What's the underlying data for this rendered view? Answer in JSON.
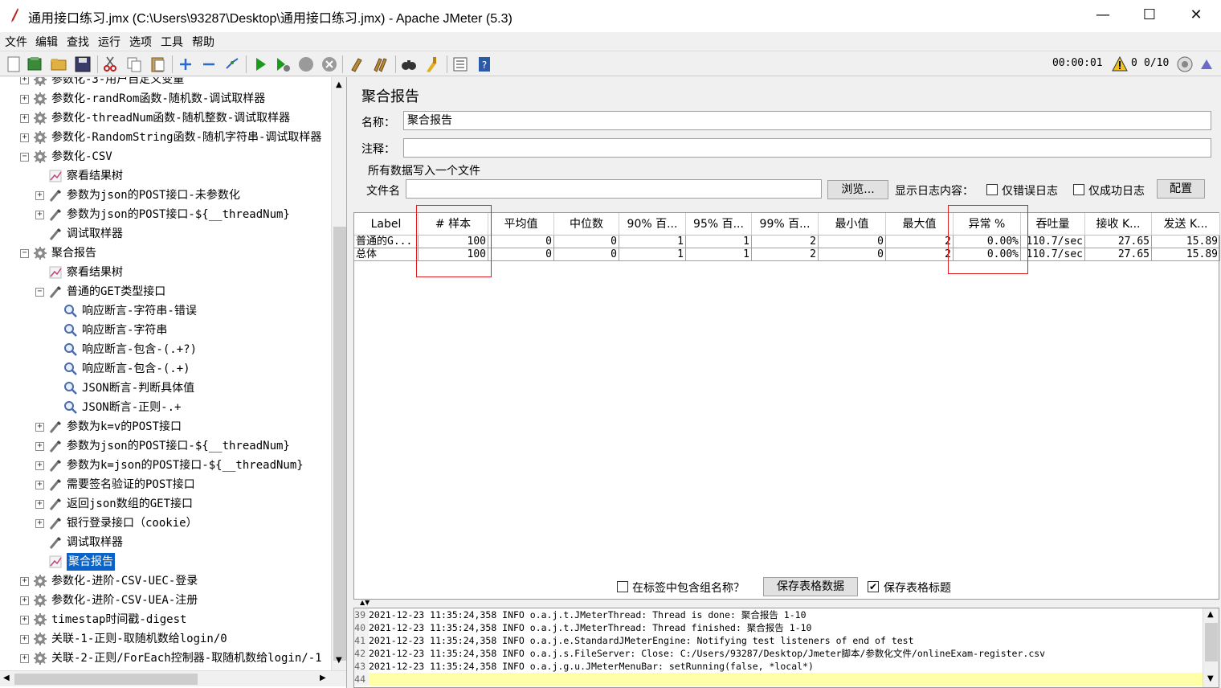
{
  "window": {
    "title": "通用接口练习.jmx (C:\\Users\\93287\\Desktop\\通用接口练习.jmx) - Apache JMeter (5.3)",
    "minimize": "—",
    "maximize": "☐",
    "close": "✕"
  },
  "menu": [
    "文件",
    "编辑",
    "查找",
    "运行",
    "选项",
    "工具",
    "帮助"
  ],
  "toolbar": {
    "icons": [
      "new-icon",
      "templates-icon",
      "open-icon",
      "save-icon",
      "cut-icon",
      "copy-icon",
      "paste-icon",
      "expand-icon",
      "collapse-icon",
      "toggle-icon",
      "start-icon",
      "start-no-pause-icon",
      "stop-icon",
      "shutdown-icon",
      "clear-icon",
      "clear-all-icon",
      "search-icon",
      "reset-search-icon",
      "function-helper-icon",
      "help-icon"
    ],
    "timer": "00:00:01",
    "warning_count": "0",
    "threads": "0/10"
  },
  "tree": {
    "items": [
      {
        "label": "参数化-3-用户自定义变量",
        "icon": "gear-icon",
        "expander": "+"
      },
      {
        "label": "参数化-randRom函数-随机数-调试取样器",
        "icon": "gear-icon",
        "expander": "+"
      },
      {
        "label": "参数化-threadNum函数-随机整数-调试取样器",
        "icon": "gear-icon",
        "expander": "+"
      },
      {
        "label": "参数化-RandomString函数-随机字符串-调试取样器",
        "icon": "gear-icon",
        "expander": "+"
      },
      {
        "label": "参数化-CSV",
        "icon": "gear-icon",
        "expander": "−"
      },
      {
        "label": "察看结果树",
        "icon": "chart-icon",
        "expander": ""
      },
      {
        "label": "参数为json的POST接口-未参数化",
        "icon": "pipette-icon",
        "expander": "+"
      },
      {
        "label": "参数为json的POST接口-${__threadNum}",
        "icon": "pipette-icon",
        "expander": "+"
      },
      {
        "label": "调试取样器",
        "icon": "pipette-icon",
        "expander": ""
      },
      {
        "label": "聚合报告",
        "icon": "gear-icon",
        "expander": "−"
      },
      {
        "label": "察看结果树",
        "icon": "chart-icon",
        "expander": ""
      },
      {
        "label": "普通的GET类型接口",
        "icon": "pipette-icon",
        "expander": "−"
      },
      {
        "label": "响应断言-字符串-错误",
        "icon": "magnifier-icon",
        "expander": ""
      },
      {
        "label": "响应断言-字符串",
        "icon": "magnifier-icon",
        "expander": ""
      },
      {
        "label": "响应断言-包含-(.+?)",
        "icon": "magnifier-icon",
        "expander": ""
      },
      {
        "label": "响应断言-包含-(.+)",
        "icon": "magnifier-icon",
        "expander": ""
      },
      {
        "label": "JSON断言-判断具体值",
        "icon": "magnifier-icon",
        "expander": ""
      },
      {
        "label": "JSON断言-正则-.+",
        "icon": "magnifier-icon",
        "expander": ""
      },
      {
        "label": "参数为k=v的POST接口",
        "icon": "pipette-icon",
        "expander": "+"
      },
      {
        "label": "参数为json的POST接口-${__threadNum}",
        "icon": "pipette-icon",
        "expander": "+"
      },
      {
        "label": "参数为k=json的POST接口-${__threadNum}",
        "icon": "pipette-icon",
        "expander": "+"
      },
      {
        "label": "需要签名验证的POST接口",
        "icon": "pipette-icon",
        "expander": "+"
      },
      {
        "label": "返回json数组的GET接口",
        "icon": "pipette-icon",
        "expander": "+"
      },
      {
        "label": "银行登录接口（cookie）",
        "icon": "pipette-icon",
        "expander": "+"
      },
      {
        "label": "调试取样器",
        "icon": "pipette-icon",
        "expander": ""
      },
      {
        "label": "聚合报告",
        "icon": "chart-icon",
        "expander": ""
      },
      {
        "label": "参数化-进阶-CSV-UEC-登录",
        "icon": "gear-icon",
        "expander": "+"
      },
      {
        "label": "参数化-进阶-CSV-UEA-注册",
        "icon": "gear-icon",
        "expander": "+"
      },
      {
        "label": "timestap时间戳-digest",
        "icon": "gear-icon",
        "expander": "+"
      },
      {
        "label": "关联-1-正则-取随机数给login/0",
        "icon": "gear-icon",
        "expander": "+"
      },
      {
        "label": "关联-2-正则/ForEach控制器-取随机数给login/-1",
        "icon": "gear-icon",
        "expander": "+"
      }
    ]
  },
  "panel": {
    "title": "聚合报告",
    "name_label": "名称：",
    "name_value": "聚合报告",
    "comment_label": "注释：",
    "comment_value": "",
    "file_section_title": "所有数据写入一个文件",
    "filename_label": "文件名",
    "filename_value": "",
    "browse_button": "浏览...",
    "log_content_label": "显示日志内容：",
    "errors_only_label": "仅错误日志",
    "success_only_label": "仅成功日志",
    "configure_button": "配置",
    "columns": [
      "Label",
      "# 样本",
      "平均值",
      "中位数",
      "90% 百...",
      "95% 百...",
      "99% 百...",
      "最小值",
      "最大值",
      "异常 %",
      "吞吐量",
      "接收 K...",
      "发送 K..."
    ],
    "rows": [
      [
        "普通的G...",
        "100",
        "0",
        "0",
        "1",
        "1",
        "2",
        "0",
        "2",
        "0.00%",
        "110.7/sec",
        "27.65",
        "15.89"
      ],
      [
        "总体",
        "100",
        "0",
        "0",
        "1",
        "1",
        "2",
        "0",
        "2",
        "0.00%",
        "110.7/sec",
        "27.65",
        "15.89"
      ]
    ],
    "include_group_label": "在标签中包含组名称？",
    "include_group_checked": false,
    "save_table_button": "保存表格数据",
    "save_header_label": "保存表格标题",
    "save_header_checked": true
  },
  "log": {
    "lines": [
      {
        "n": "39",
        "text": "2021-12-23 11:35:24,358 INFO o.a.j.t.JMeterThread: Thread is done: 聚合报告 1-10"
      },
      {
        "n": "40",
        "text": "2021-12-23 11:35:24,358 INFO o.a.j.t.JMeterThread: Thread finished: 聚合报告 1-10"
      },
      {
        "n": "41",
        "text": "2021-12-23 11:35:24,358 INFO o.a.j.e.StandardJMeterEngine: Notifying test listeners of end of test"
      },
      {
        "n": "42",
        "text": "2021-12-23 11:35:24,358 INFO o.a.j.s.FileServer: Close: C:/Users/93287/Desktop/Jmeter脚本/参数化文件/onlineExam-register.csv"
      },
      {
        "n": "43",
        "text": "2021-12-23 11:35:24,358 INFO o.a.j.g.u.JMeterMenuBar: setRunning(false, *local*)"
      },
      {
        "n": "44",
        "text": ""
      }
    ]
  }
}
